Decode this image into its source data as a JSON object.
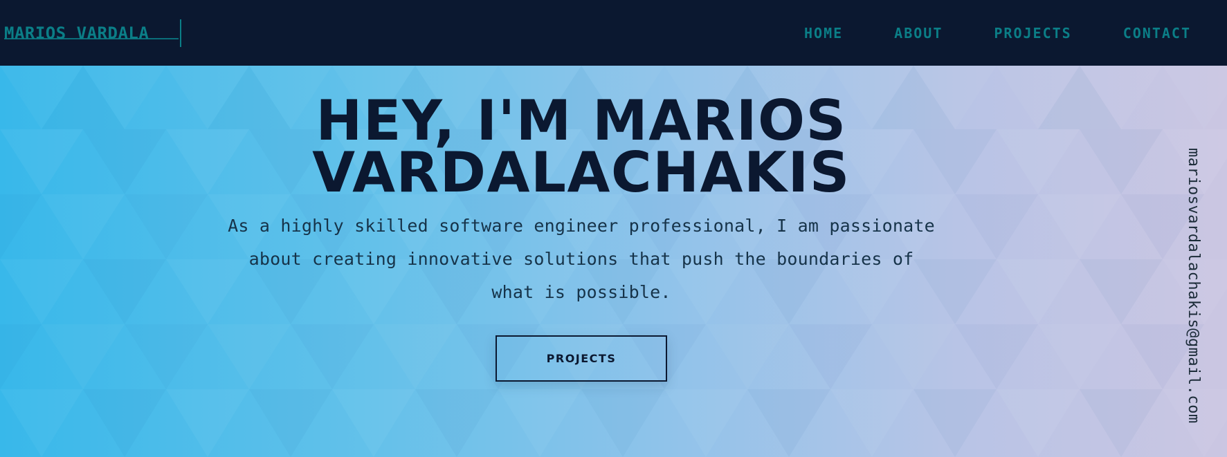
{
  "header": {
    "brand": "MARIOS VARDALA",
    "nav": [
      "HOME",
      "ABOUT",
      "PROJECTS",
      "CONTACT"
    ]
  },
  "hero": {
    "title_line1": "HEY, I'M MARIOS",
    "title_line2": "VARDALACHAKIS",
    "description": "As a highly skilled software engineer professional, I am passionate about creating innovative solutions that push the boundaries of what is possible.",
    "cta_label": "PROJECTS",
    "email": "mariosvardalachakis@gmail.com"
  },
  "colors": {
    "navbar_bg": "#0b1830",
    "nav_text": "#0b7e87",
    "hero_gradient_start": "#38b8ea",
    "hero_gradient_end": "#cbc6e2",
    "title_text": "#0b1830"
  }
}
